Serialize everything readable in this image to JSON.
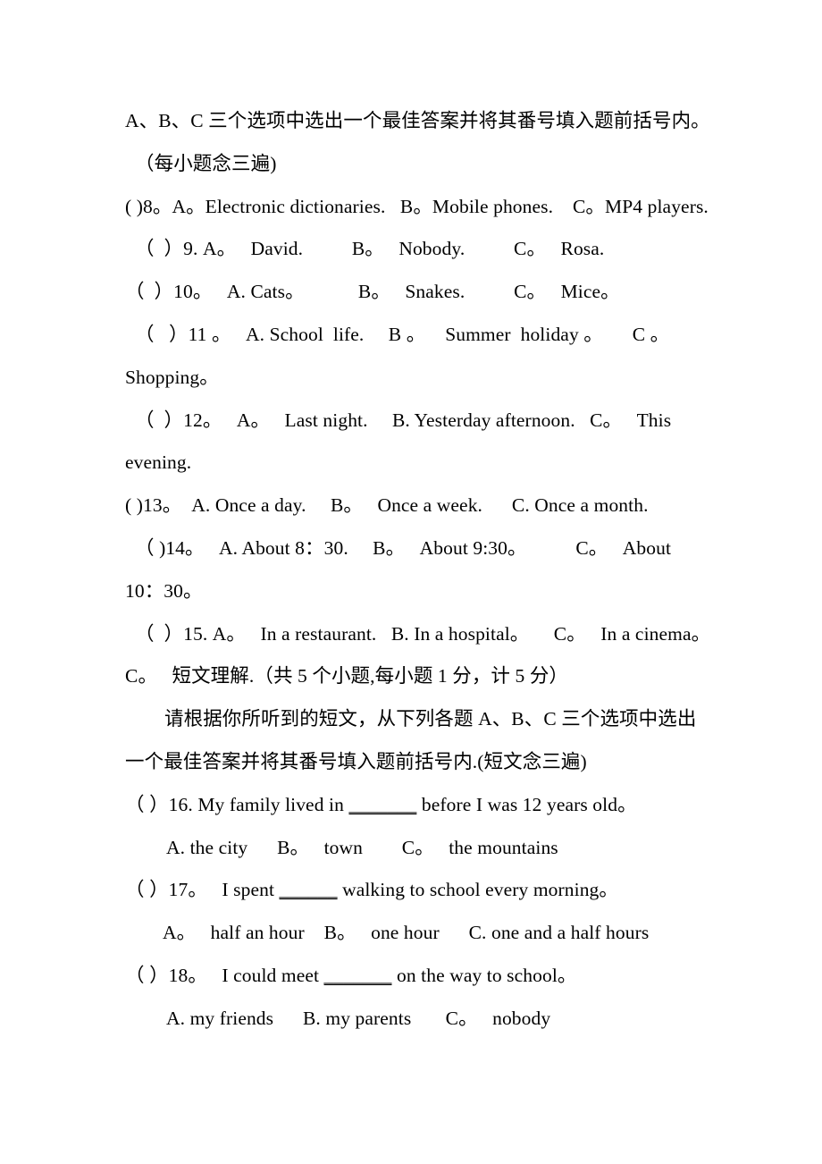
{
  "document": {
    "type": "exam-paper-scan",
    "language": "zh-CN/en",
    "page_background": "#ffffff",
    "text_color": "#000000"
  },
  "lines": {
    "intro_1": "A、B、C 三个选项中选出一个最佳答案并将其番号填入题前括号内。",
    "intro_2": "（每小题念三遍)",
    "q8": "( )8。A。Electronic dictionaries.   B。Mobile phones.    C。MP4 players.",
    "q9": "（  ）9. A。   David.          B。   Nobody.          C。   Rosa.",
    "q10": "（  ）10。   A. Cats。           B。   Snakes.          C。   Mice。",
    "q11": "（   ）11 。   A. School  life.     B 。    Summer  holiday 。      C 。",
    "q11_wrap": "Shopping。",
    "q12": "（  ）12。   A。   Last night.     B. Yesterday afternoon.   C。   This",
    "q12_wrap": "evening.",
    "q13": "( )13。  A. Once a day.     B。   Once a week.      C. Once a month.",
    "q14": "（ )14。   A. About 8：30.     B。   About 9:30。          C。   About",
    "q14_wrap": "10：30。",
    "q15": "（  ）15. A。   In a restaurant.   B. In a hospital。     C。   In a cinema。",
    "section_c": "C。   短文理解.（共 5 个小题,每小题 1 分，计 5 分）",
    "section_c_instr_1": "请根据你所听到的短文，从下列各题 A、B、C 三个选项中选出",
    "section_c_instr_2": "一个最佳答案并将其番号填入题前括号内.(短文念三遍)",
    "q16": "（ ）16. My family lived in ",
    "q16_blank": "_______",
    "q16_tail": " before I was 12 years old。",
    "q16_options": "A. the city      B。   town        C。   the mountains",
    "q17": "（ ）17。   I spent ",
    "q17_blank": "______",
    "q17_tail": " walking to school every morning。",
    "q17_options": "A。   half an hour    B。   one hour      C. one and a half hours",
    "q18": "（ ）18。   I could meet ",
    "q18_blank": "_______",
    "q18_tail": " on the way to school。",
    "q18_options": "A. my friends      B. my parents       C。   nobody"
  }
}
